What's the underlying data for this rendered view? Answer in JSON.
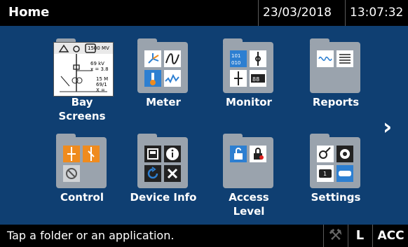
{
  "header": {
    "title": "Home",
    "date": "23/03/2018",
    "time": "13:07:32"
  },
  "tiles": [
    {
      "label": "Bay\nScreens"
    },
    {
      "label": "Meter"
    },
    {
      "label": "Monitor"
    },
    {
      "label": "Reports"
    },
    {
      "label": "Control"
    },
    {
      "label": "Device Info"
    },
    {
      "label": "Access\nLevel"
    },
    {
      "label": "Settings"
    }
  ],
  "bay_diagram_text": [
    "1500 MV",
    "69 kV",
    "x = 3.8",
    "15 M",
    "69/1",
    "X ="
  ],
  "status": {
    "message": "Tap a folder or an application.",
    "local_label": "L",
    "access_label": "ACC"
  },
  "icons": [
    "chevron-right-icon",
    "tools-icon"
  ],
  "colors": {
    "background": "#0f3f72",
    "folder": "#9aa3ad",
    "accent_orange": "#ef8b1e",
    "accent_blue": "#2d7fd1",
    "bars": "#000000"
  }
}
